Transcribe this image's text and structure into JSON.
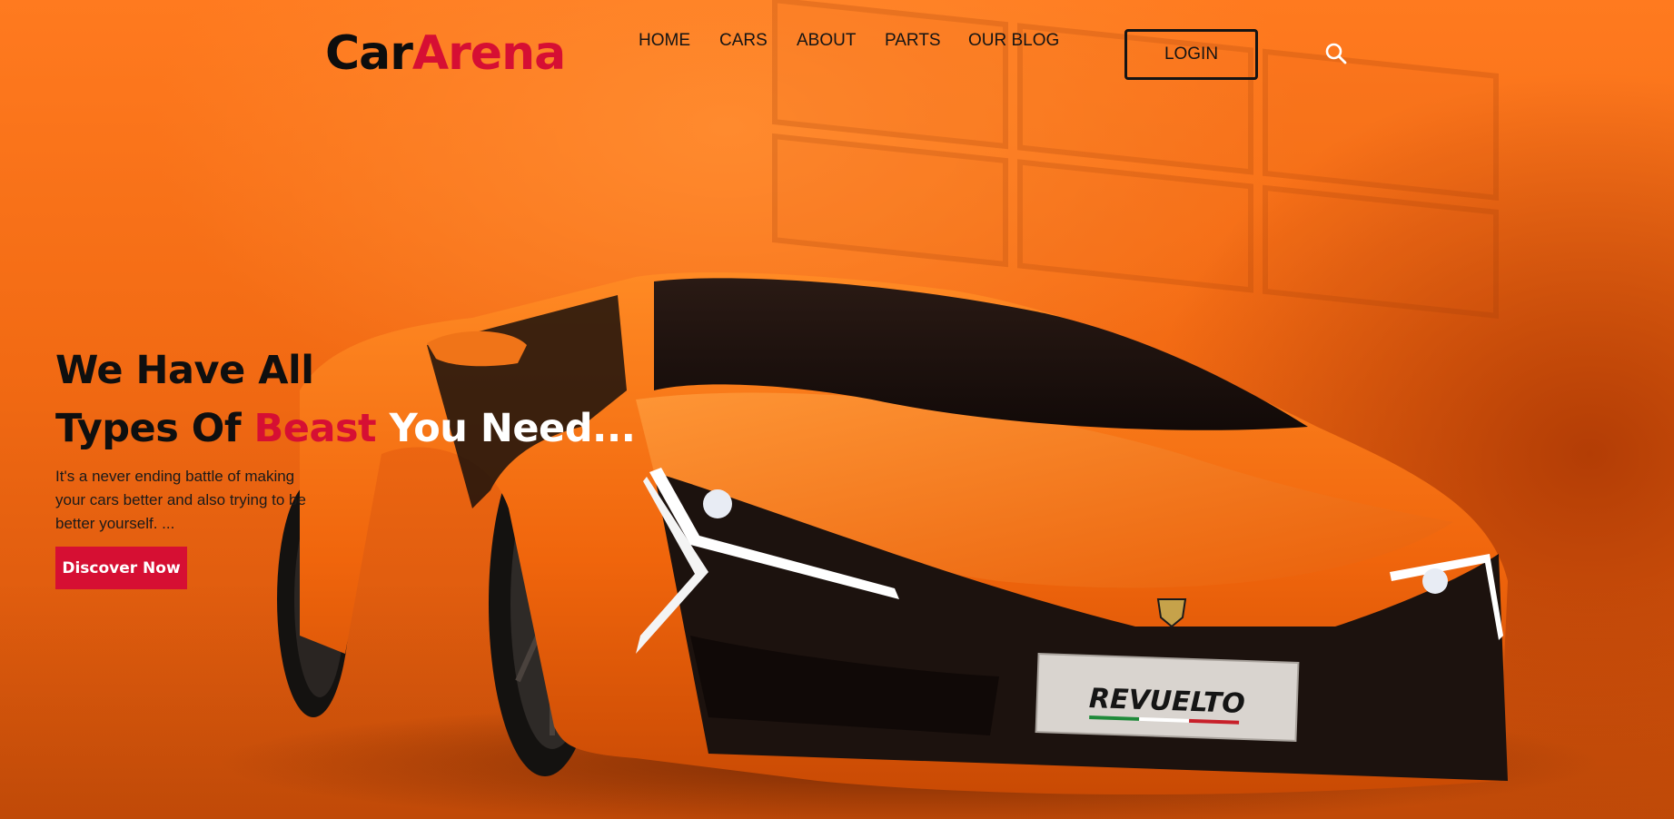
{
  "header": {
    "logo": {
      "part1": "Car",
      "part2": "Arena"
    },
    "nav": [
      {
        "label": "HOME"
      },
      {
        "label": "CARS"
      },
      {
        "label": "ABOUT"
      },
      {
        "label": "PARTS"
      },
      {
        "label": "OUR BLOG"
      }
    ],
    "login_label": "LOGIN",
    "search_icon": "search-icon"
  },
  "hero": {
    "title_line1": "We Have All",
    "title_line2_a": "Types Of ",
    "title_line2_b": "Beast",
    "title_line2_c": " You Need...",
    "subtitle": "It's a never ending battle of making your cars better and also trying to be better yourself. ...",
    "cta_label": "Discover Now"
  },
  "car": {
    "plate_text": "REVUELTO"
  },
  "colors": {
    "accent": "#d60f33",
    "background": "#f26a13",
    "text": "#0f0f0f"
  }
}
